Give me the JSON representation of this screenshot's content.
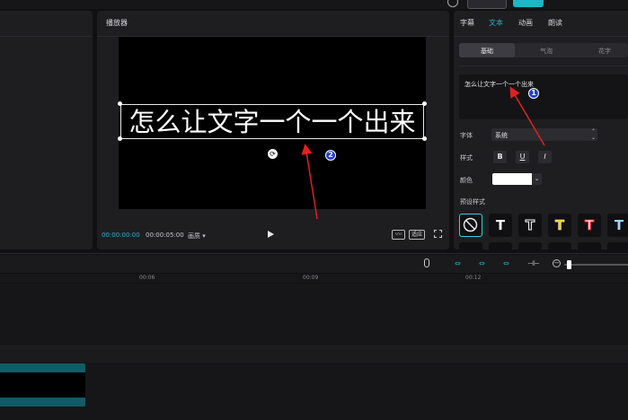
{
  "player": {
    "title": "播放器",
    "caption_text": "怎么让文字一个一个出来",
    "time_current": "00:00:00:00",
    "time_total": "00:00:05:00",
    "ratio_label": "画质 ▾",
    "ratio_button": "适应"
  },
  "right_panel": {
    "tabs": [
      "字幕",
      "文本",
      "动画",
      "朗读"
    ],
    "active_tab": "文本",
    "segments": [
      "基础",
      "气泡",
      "花字"
    ],
    "text_value": "怎么让文字一个一个出来",
    "font_label": "字体",
    "font_value": "系统",
    "style_label": "样式",
    "style_buttons": [
      "B",
      "U",
      "I"
    ],
    "color_label": "颜色",
    "color_value": "#ffffff",
    "preset_label": "预设样式",
    "preset_letters": [
      "T",
      "T",
      "T",
      "T",
      "T"
    ]
  },
  "timeline": {
    "ticks": [
      "00:06",
      "00:09",
      "00:12"
    ]
  },
  "annotations": {
    "marker1": "1",
    "marker2": "2"
  },
  "colors": {
    "accent": "#1fb5c3",
    "annotation_arrow": "#e02020",
    "marker_fill": "#1f3bd6"
  }
}
